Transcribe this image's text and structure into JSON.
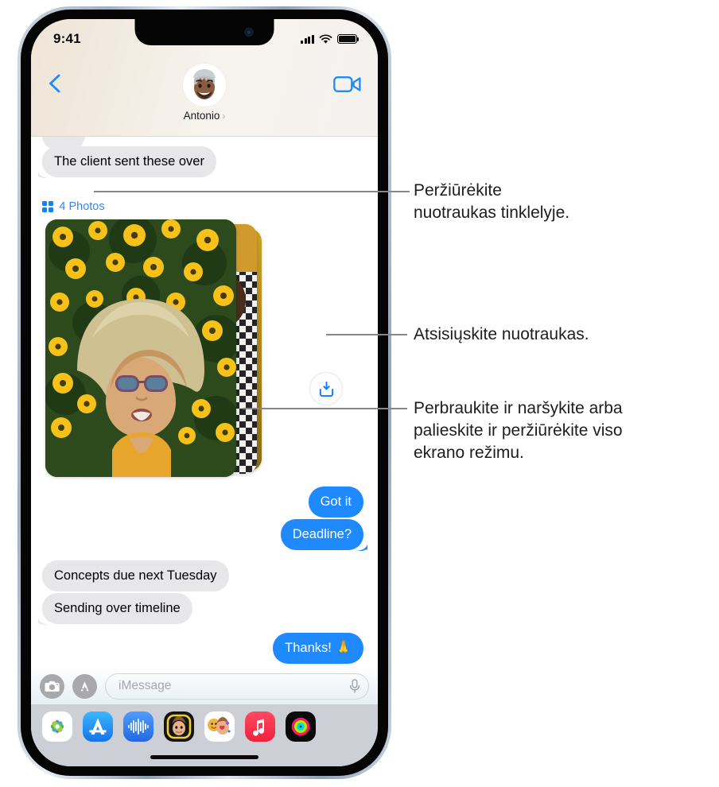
{
  "status_bar": {
    "time": "9:41",
    "signal_icon": "cellular-bars-icon",
    "wifi_icon": "wifi-icon",
    "battery_icon": "battery-icon"
  },
  "nav": {
    "back_icon": "back-chevron-icon",
    "facetime_icon": "facetime-video-icon",
    "contact_name": "Antonio",
    "contact_chevron": "›",
    "avatar_label": "memoji-avatar"
  },
  "conversation": {
    "messages": [
      {
        "text": "The client sent these over",
        "side": "incoming"
      },
      {
        "text": "Got it",
        "side": "outgoing"
      },
      {
        "text": "Deadline?",
        "side": "outgoing"
      },
      {
        "text": "Concepts due next Tuesday",
        "side": "incoming"
      },
      {
        "text": "Sending over timeline",
        "side": "incoming"
      },
      {
        "text": "Thanks! 🙏",
        "side": "outgoing"
      }
    ],
    "photos_label": "4 Photos",
    "photos_grid_icon": "grid-icon",
    "download_icon": "download-tray-icon"
  },
  "toolbar": {
    "camera_icon": "camera-icon",
    "apps_icon": "app-store-messages-icon",
    "placeholder": "iMessage",
    "mic_icon": "microphone-icon"
  },
  "app_drawer": [
    {
      "name": "photos-app-icon"
    },
    {
      "name": "app-store-app-icon"
    },
    {
      "name": "audio-message-app-icon"
    },
    {
      "name": "memoji-app-icon"
    },
    {
      "name": "memoji-stickers-app-icon"
    },
    {
      "name": "music-app-icon"
    },
    {
      "name": "fitness-app-icon"
    }
  ],
  "callouts": [
    {
      "id": "grid",
      "lines": [
        "Peržiūrėkite",
        "nuotraukas tinklelyje."
      ]
    },
    {
      "id": "download",
      "lines": [
        "Atsisiųskite nuotraukas."
      ]
    },
    {
      "id": "browse",
      "lines": [
        "Perbraukite ir naršykite arba",
        "palieskite ir peržiūrėkite viso",
        "ekrano režimu."
      ]
    }
  ],
  "colors": {
    "accent_blue": "#1f8aff",
    "link_blue": "#3d85e8",
    "bubble_gray": "#e7e7e9",
    "leader_gray": "#86868b",
    "drawer_gray": "#ccd0d6"
  }
}
